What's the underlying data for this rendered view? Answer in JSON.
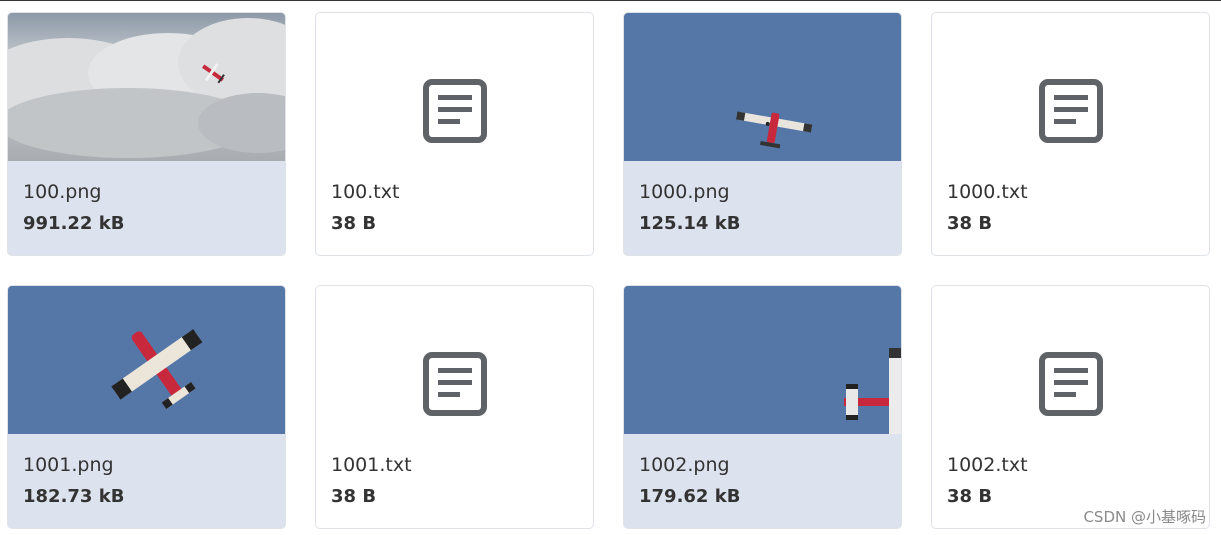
{
  "files": [
    {
      "name": "100.png",
      "size": "991.22 kB",
      "type": "image",
      "thumb": "clouds-plane"
    },
    {
      "name": "100.txt",
      "size": "38 B",
      "type": "text",
      "icon": "document-icon"
    },
    {
      "name": "1000.png",
      "size": "125.14 kB",
      "type": "image",
      "thumb": "sky-plane-small"
    },
    {
      "name": "1000.txt",
      "size": "38 B",
      "type": "text",
      "icon": "document-icon"
    },
    {
      "name": "1001.png",
      "size": "182.73 kB",
      "type": "image",
      "thumb": "sky-plane-large"
    },
    {
      "name": "1001.txt",
      "size": "38 B",
      "type": "text",
      "icon": "document-icon"
    },
    {
      "name": "1002.png",
      "size": "179.62 kB",
      "type": "image",
      "thumb": "sky-plane-edge"
    },
    {
      "name": "1002.txt",
      "size": "38 B",
      "type": "text",
      "icon": "document-icon"
    }
  ],
  "watermark": "CSDN @小基啄码",
  "colors": {
    "sky": "#5577a8",
    "card_image_bg": "#dde3ee",
    "doc_icon": "#5f6368",
    "plane_red": "#c8283c"
  }
}
